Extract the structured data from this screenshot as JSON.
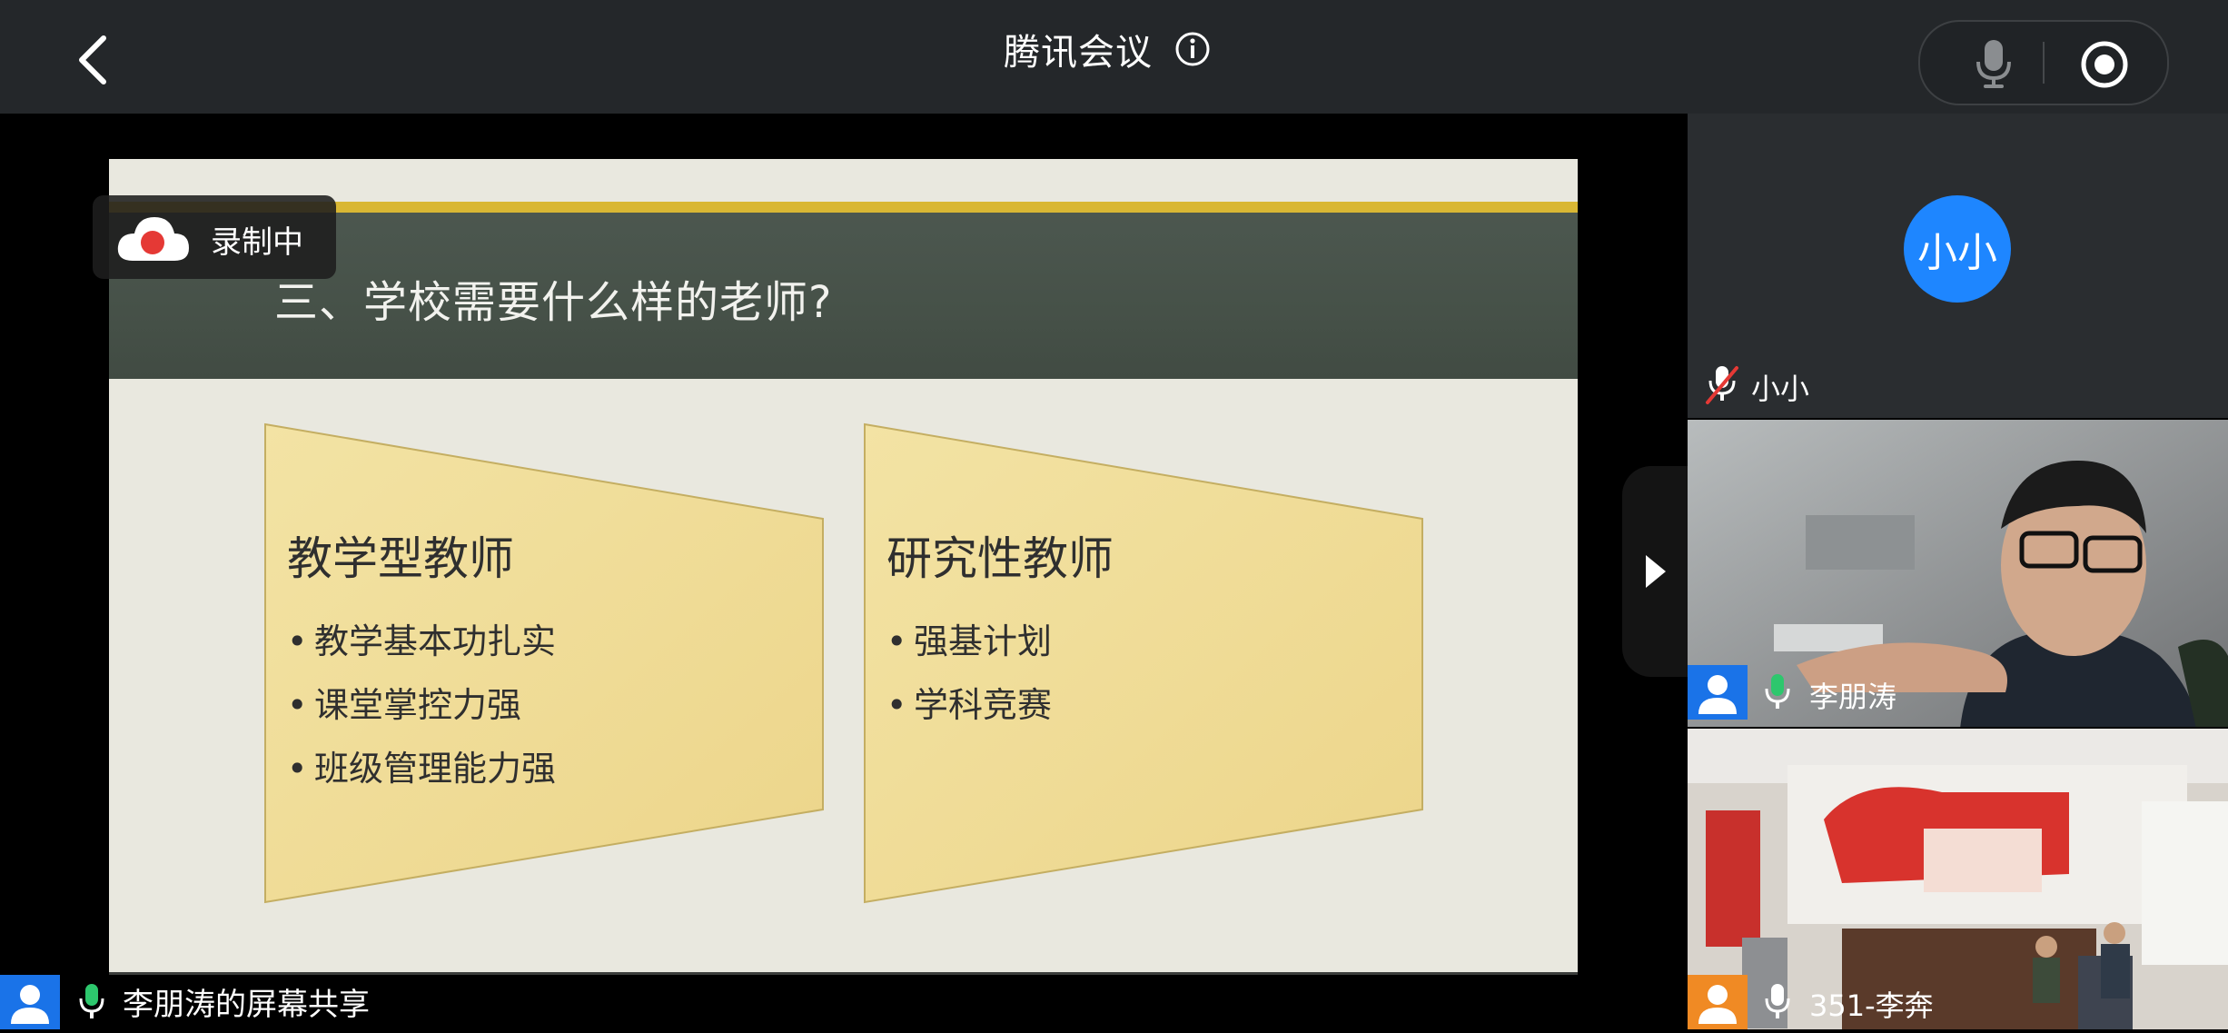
{
  "app": {
    "title": "腾讯会议"
  },
  "recording": {
    "label": "录制中"
  },
  "slide": {
    "title": "三、学校需要什么样的老师?",
    "boxes": [
      {
        "heading": "教学型教师",
        "items": [
          "教学基本功扎实",
          "课堂掌控力强",
          "班级管理能力强"
        ]
      },
      {
        "heading": "研究性教师",
        "items": [
          "强基计划",
          "学科竞赛"
        ]
      }
    ]
  },
  "screen_share": {
    "label": "李朋涛的屏幕共享"
  },
  "participants": [
    {
      "name": "小小",
      "avatar_text": "小小",
      "mic": "muted"
    },
    {
      "name": "李朋涛",
      "mic": "on"
    },
    {
      "name": "351-李奔",
      "mic": "on"
    }
  ],
  "colors": {
    "topbar": "#24272a",
    "slide_header": "#465148",
    "slide_band": "#d9b734",
    "box_fill": "#f0de9a",
    "avatar_blue": "#1e86ff",
    "user_chip_blue": "#1a73e8",
    "user_chip_orange": "#f08a24",
    "mic_green": "#2dc76d"
  },
  "icons": [
    "back-arrow-icon",
    "info-icon",
    "microphone-icon",
    "record-toggle-icon",
    "cloud-record-icon",
    "expand-arrow-icon",
    "user-icon",
    "mic-muted-icon"
  ]
}
